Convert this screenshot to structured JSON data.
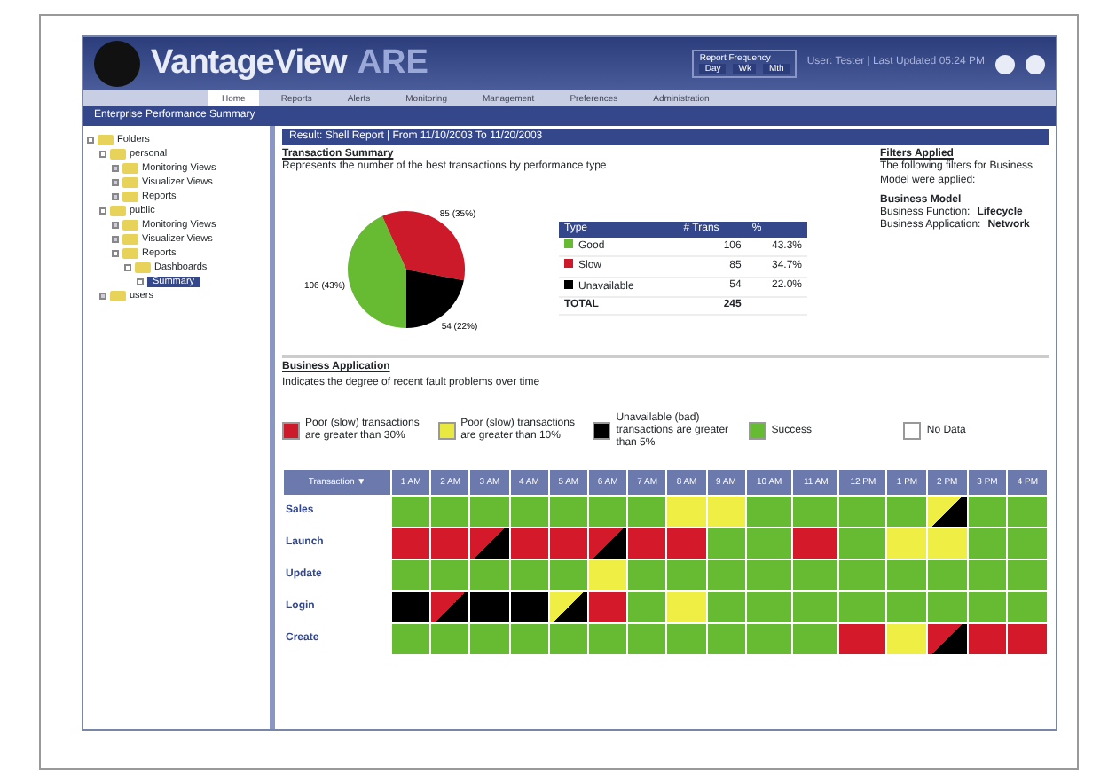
{
  "header": {
    "logo": "VantageView",
    "product": "ARE",
    "clock_label": "Report Frequency",
    "clock_buttons": [
      "Day",
      "Wk",
      "Mth"
    ],
    "user_text": "User: Tester | Last Updated 05:24 PM"
  },
  "nav_tabs": [
    {
      "label": "Home",
      "selected": true
    },
    {
      "label": "Reports",
      "selected": false
    },
    {
      "label": "Alerts",
      "selected": false
    },
    {
      "label": "Monitoring",
      "selected": false
    },
    {
      "label": "Management",
      "selected": false
    },
    {
      "label": "Preferences",
      "selected": false
    },
    {
      "label": "Administration",
      "selected": false
    }
  ],
  "title_bar": "Enterprise Performance Summary",
  "tree": [
    {
      "label": "Folders",
      "expanded": true,
      "children": [
        {
          "label": "personal",
          "expanded": true,
          "children": [
            {
              "label": "Monitoring Views",
              "expanded": false
            },
            {
              "label": "Visualizer Views",
              "expanded": false
            },
            {
              "label": "Reports",
              "expanded": false
            }
          ]
        },
        {
          "label": "public",
          "expanded": true,
          "children": [
            {
              "label": "Monitoring Views",
              "expanded": false
            },
            {
              "label": "Visualizer Views",
              "expanded": false
            },
            {
              "label": "Reports",
              "expanded": true,
              "children": [
                {
                  "label": "Dashboards",
                  "expanded": true,
                  "children": [
                    {
                      "label": "Summary",
                      "selected": true
                    }
                  ]
                }
              ]
            }
          ]
        },
        {
          "label": "users",
          "expanded": false
        }
      ]
    }
  ],
  "report_bar": "Result: Shell Report | From 11/10/2003 To 11/20/2003",
  "summary": {
    "title": "Transaction Summary",
    "subtitle": "Represents the number of the best transactions by performance type",
    "pie_labels": [
      "106 (43%)",
      "85 (35%)",
      "54 (22%)"
    ],
    "table": {
      "columns": [
        "Type",
        "# Trans",
        "%"
      ],
      "rows": [
        {
          "color": "#66bb33",
          "cells": [
            "Good",
            "106",
            "43.3%"
          ]
        },
        {
          "color": "#cc1a2a",
          "cells": [
            "Slow",
            "85",
            "34.7%"
          ]
        },
        {
          "color": "#000000",
          "cells": [
            "Unavailable",
            "54",
            "22.0%"
          ]
        }
      ],
      "total": [
        "TOTAL",
        "245"
      ]
    }
  },
  "filters": {
    "title": "Filters Applied",
    "text": "The following filters for Business Model were applied:",
    "model_title": "Business Model",
    "items": [
      {
        "label": "Business Function:",
        "value": "Lifecycle"
      },
      {
        "label": "Business Application:",
        "value": "Network"
      }
    ]
  },
  "business": {
    "title": "Business Application",
    "subtitle": "Indicates the degree of recent fault problems over time",
    "legend": [
      {
        "color": "#cc1a2a",
        "text": "Poor (slow) transactions are greater than 30%"
      },
      {
        "color": "#e8e840",
        "text": "Poor (slow) transactions are greater than 10%"
      },
      {
        "color": "#000000",
        "text": "Unavailable (bad) transactions are greater than 5%"
      },
      {
        "color": "#66bb33",
        "text": "Success"
      },
      {
        "color": "#ffffff",
        "text": "No Data"
      }
    ],
    "heat": {
      "corner": "Transaction ▼",
      "columns": [
        "1 AM",
        "2 AM",
        "3 AM",
        "4 AM",
        "5 AM",
        "6 AM",
        "7 AM",
        "8 AM",
        "9 AM",
        "10 AM",
        "11 AM",
        "12 PM",
        "1 PM",
        "2 PM",
        "3 PM",
        "4 PM"
      ],
      "rows": [
        {
          "label": "Sales",
          "cells": [
            {
              "kind": "solid",
              "color": "#66bb33"
            },
            {
              "kind": "solid",
              "color": "#66bb33"
            },
            {
              "kind": "solid",
              "color": "#66bb33"
            },
            {
              "kind": "solid",
              "color": "#66bb33"
            },
            {
              "kind": "solid",
              "color": "#66bb33"
            },
            {
              "kind": "solid",
              "color": "#66bb33"
            },
            {
              "kind": "solid",
              "color": "#66bb33"
            },
            {
              "kind": "solid",
              "color": "#eeee44"
            },
            {
              "kind": "solid",
              "color": "#eeee44"
            },
            {
              "kind": "solid",
              "color": "#66bb33"
            },
            {
              "kind": "solid",
              "color": "#66bb33"
            },
            {
              "kind": "solid",
              "color": "#66bb33"
            },
            {
              "kind": "solid",
              "color": "#66bb33"
            },
            {
              "kind": "split",
              "color": "#eeee44"
            },
            {
              "kind": "solid",
              "color": "#66bb33"
            },
            {
              "kind": "solid",
              "color": "#66bb33"
            }
          ]
        },
        {
          "label": "Launch",
          "cells": [
            {
              "kind": "solid",
              "color": "#d41a2a"
            },
            {
              "kind": "solid",
              "color": "#d41a2a"
            },
            {
              "kind": "split",
              "color": "#d41a2a"
            },
            {
              "kind": "solid",
              "color": "#d41a2a"
            },
            {
              "kind": "solid",
              "color": "#d41a2a"
            },
            {
              "kind": "split",
              "color": "#d41a2a"
            },
            {
              "kind": "solid",
              "color": "#d41a2a"
            },
            {
              "kind": "solid",
              "color": "#d41a2a"
            },
            {
              "kind": "solid",
              "color": "#66bb33"
            },
            {
              "kind": "solid",
              "color": "#66bb33"
            },
            {
              "kind": "solid",
              "color": "#d41a2a"
            },
            {
              "kind": "solid",
              "color": "#66bb33"
            },
            {
              "kind": "solid",
              "color": "#eeee44"
            },
            {
              "kind": "solid",
              "color": "#eeee44"
            },
            {
              "kind": "solid",
              "color": "#66bb33"
            },
            {
              "kind": "solid",
              "color": "#66bb33"
            }
          ]
        },
        {
          "label": "Update",
          "cells": [
            {
              "kind": "solid",
              "color": "#66bb33"
            },
            {
              "kind": "solid",
              "color": "#66bb33"
            },
            {
              "kind": "solid",
              "color": "#66bb33"
            },
            {
              "kind": "solid",
              "color": "#66bb33"
            },
            {
              "kind": "solid",
              "color": "#66bb33"
            },
            {
              "kind": "solid",
              "color": "#eeee44"
            },
            {
              "kind": "solid",
              "color": "#66bb33"
            },
            {
              "kind": "solid",
              "color": "#66bb33"
            },
            {
              "kind": "solid",
              "color": "#66bb33"
            },
            {
              "kind": "solid",
              "color": "#66bb33"
            },
            {
              "kind": "solid",
              "color": "#66bb33"
            },
            {
              "kind": "solid",
              "color": "#66bb33"
            },
            {
              "kind": "solid",
              "color": "#66bb33"
            },
            {
              "kind": "solid",
              "color": "#66bb33"
            },
            {
              "kind": "solid",
              "color": "#66bb33"
            },
            {
              "kind": "solid",
              "color": "#66bb33"
            }
          ]
        },
        {
          "label": "Login",
          "cells": [
            {
              "kind": "solid",
              "color": "#000000"
            },
            {
              "kind": "split",
              "color": "#d41a2a"
            },
            {
              "kind": "solid",
              "color": "#000000"
            },
            {
              "kind": "solid",
              "color": "#000000"
            },
            {
              "kind": "split",
              "color": "#eeee44"
            },
            {
              "kind": "solid",
              "color": "#d41a2a"
            },
            {
              "kind": "solid",
              "color": "#66bb33"
            },
            {
              "kind": "solid",
              "color": "#eeee44"
            },
            {
              "kind": "solid",
              "color": "#66bb33"
            },
            {
              "kind": "solid",
              "color": "#66bb33"
            },
            {
              "kind": "solid",
              "color": "#66bb33"
            },
            {
              "kind": "solid",
              "color": "#66bb33"
            },
            {
              "kind": "solid",
              "color": "#66bb33"
            },
            {
              "kind": "solid",
              "color": "#66bb33"
            },
            {
              "kind": "solid",
              "color": "#66bb33"
            },
            {
              "kind": "solid",
              "color": "#66bb33"
            }
          ]
        },
        {
          "label": "Create",
          "cells": [
            {
              "kind": "solid",
              "color": "#66bb33"
            },
            {
              "kind": "solid",
              "color": "#66bb33"
            },
            {
              "kind": "solid",
              "color": "#66bb33"
            },
            {
              "kind": "solid",
              "color": "#66bb33"
            },
            {
              "kind": "solid",
              "color": "#66bb33"
            },
            {
              "kind": "solid",
              "color": "#66bb33"
            },
            {
              "kind": "solid",
              "color": "#66bb33"
            },
            {
              "kind": "solid",
              "color": "#66bb33"
            },
            {
              "kind": "solid",
              "color": "#66bb33"
            },
            {
              "kind": "solid",
              "color": "#66bb33"
            },
            {
              "kind": "solid",
              "color": "#66bb33"
            },
            {
              "kind": "solid",
              "color": "#d41a2a"
            },
            {
              "kind": "solid",
              "color": "#eeee44"
            },
            {
              "kind": "split",
              "color": "#d41a2a"
            },
            {
              "kind": "solid",
              "color": "#d41a2a"
            },
            {
              "kind": "solid",
              "color": "#d41a2a"
            }
          ]
        }
      ]
    }
  }
}
